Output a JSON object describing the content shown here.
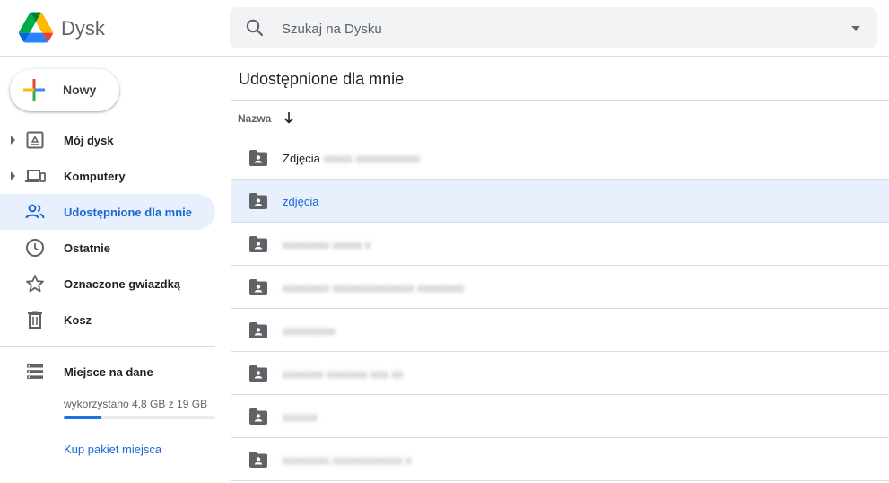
{
  "app": {
    "title": "Dysk",
    "logo_icon": "google-drive-logo"
  },
  "search": {
    "placeholder": "Szukaj na Dysku",
    "value": "",
    "search_icon": "search-icon",
    "options_icon": "caret-down-icon"
  },
  "sidebar": {
    "new_button": {
      "label": "Nowy",
      "icon": "plus-multicolor-icon"
    },
    "items": [
      {
        "label": "Mój dysk",
        "icon": "drive-icon",
        "expandable": true,
        "active": false
      },
      {
        "label": "Komputery",
        "icon": "computer-devices-icon",
        "expandable": true,
        "active": false
      },
      {
        "label": "Udostępnione dla mnie",
        "icon": "shared-people-icon",
        "expandable": false,
        "active": true
      },
      {
        "label": "Ostatnie",
        "icon": "clock-icon",
        "expandable": false,
        "active": false
      },
      {
        "label": "Oznaczone gwiazdką",
        "icon": "star-icon",
        "expandable": false,
        "active": false
      },
      {
        "label": "Kosz",
        "icon": "trash-icon",
        "expandable": false,
        "active": false
      }
    ],
    "storage": {
      "title": "Miejsce na dane",
      "icon": "storage-icon",
      "usage_text": "wykorzystano 4,8 GB z 19 GB",
      "used_fraction": 0.25,
      "buy_link": "Kup pakiet miejsca"
    }
  },
  "main": {
    "title": "Udostępnione dla mnie",
    "sort": {
      "label": "Nazwa",
      "direction_icon": "arrow-down-icon"
    },
    "files": [
      {
        "name": "Zdjęcia",
        "blurred_suffix": "xxxxx xxxxxxxxxxx",
        "selected": false
      },
      {
        "name": "zdjęcia",
        "blurred_suffix": "",
        "selected": true
      },
      {
        "name": "",
        "blurred_suffix": "xxxxxxxx xxxxx x",
        "selected": false
      },
      {
        "name": "",
        "blurred_suffix": "xxxxxxxx xxxxxxxxxxxxxx xxxxxxxx",
        "selected": false
      },
      {
        "name": "",
        "blurred_suffix": "xxxxxxxxx",
        "selected": false
      },
      {
        "name": "",
        "blurred_suffix": "xxxxxxx xxxxxxx xxx xx",
        "selected": false
      },
      {
        "name": "",
        "blurred_suffix": "xxxxxx",
        "selected": false
      },
      {
        "name": "",
        "blurred_suffix": "xxxxxxxx xxxxxxxxxxxx x",
        "selected": false
      }
    ]
  },
  "colors": {
    "accent": "#1967d2",
    "active_bg": "#e8f0fe",
    "divider": "#dadce0",
    "icon_gray": "#5f6368"
  }
}
